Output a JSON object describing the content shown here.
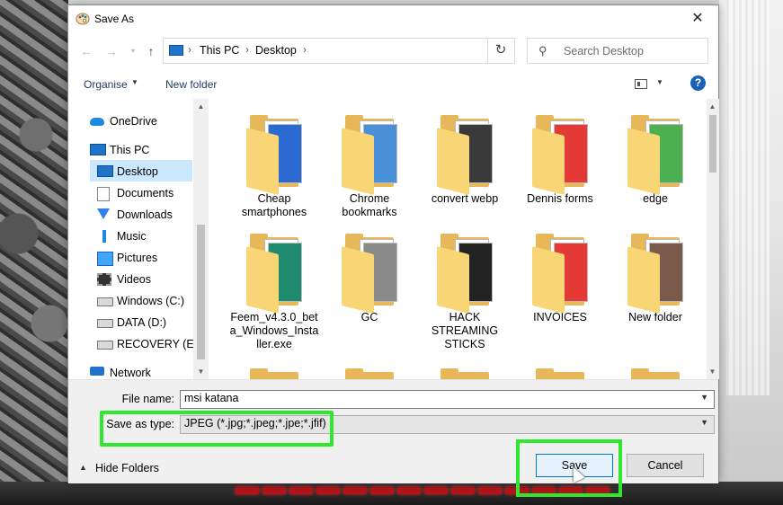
{
  "window": {
    "title": "Save As",
    "close_glyph": "✕"
  },
  "address": {
    "crumbs": [
      "This PC",
      "Desktop"
    ],
    "search_placeholder": "Search Desktop"
  },
  "toolbar": {
    "organise_label": "Organise",
    "new_folder_label": "New folder",
    "help_glyph": "?"
  },
  "nav": {
    "items": [
      {
        "label": "OneDrive",
        "icon": "cloud-icon"
      },
      {
        "label": "This PC",
        "icon": "computer-icon"
      },
      {
        "label": "Desktop",
        "icon": "desktop-icon",
        "selected": true
      },
      {
        "label": "Documents",
        "icon": "documents-icon"
      },
      {
        "label": "Downloads",
        "icon": "downloads-icon"
      },
      {
        "label": "Music",
        "icon": "music-icon"
      },
      {
        "label": "Pictures",
        "icon": "pictures-icon"
      },
      {
        "label": "Videos",
        "icon": "videos-icon"
      },
      {
        "label": "Windows (C:)",
        "icon": "drive-icon"
      },
      {
        "label": "DATA (D:)",
        "icon": "drive-icon"
      },
      {
        "label": "RECOVERY (E:)",
        "icon": "drive-icon"
      },
      {
        "label": "Network",
        "icon": "network-icon"
      }
    ]
  },
  "folders": [
    {
      "label": "Cheap smartphones",
      "preview": "#2b6bd1"
    },
    {
      "label": "Chrome bookmarks",
      "preview": "#4a90d9"
    },
    {
      "label": "convert webp",
      "preview": "#3a3a3a"
    },
    {
      "label": "Dennis forms",
      "preview": "#e53935"
    },
    {
      "label": "edge",
      "preview": "#4caf50"
    },
    {
      "label": "Feem_v4.3.0_beta_Windows_Installer.exe",
      "preview": "#1e8a6e"
    },
    {
      "label": "GC",
      "preview": "#8a8a8a"
    },
    {
      "label": "HACK STREAMING STICKS",
      "preview": "#222222"
    },
    {
      "label": "INVOICES",
      "preview": "#e53935"
    },
    {
      "label": "New folder",
      "preview": "#7a5a4a"
    }
  ],
  "bottom": {
    "filename_label": "File name:",
    "filename_value": "msi katana",
    "type_label": "Save as type:",
    "type_value": "JPEG (*.jpg;*.jpeg;*.jpe;*.jfif)",
    "hide_folders_label": "Hide Folders",
    "save_label": "Save",
    "cancel_label": "Cancel"
  },
  "colors": {
    "highlight": "#2ee82e",
    "selection": "#cce8ff",
    "accent": "#0078d7"
  }
}
